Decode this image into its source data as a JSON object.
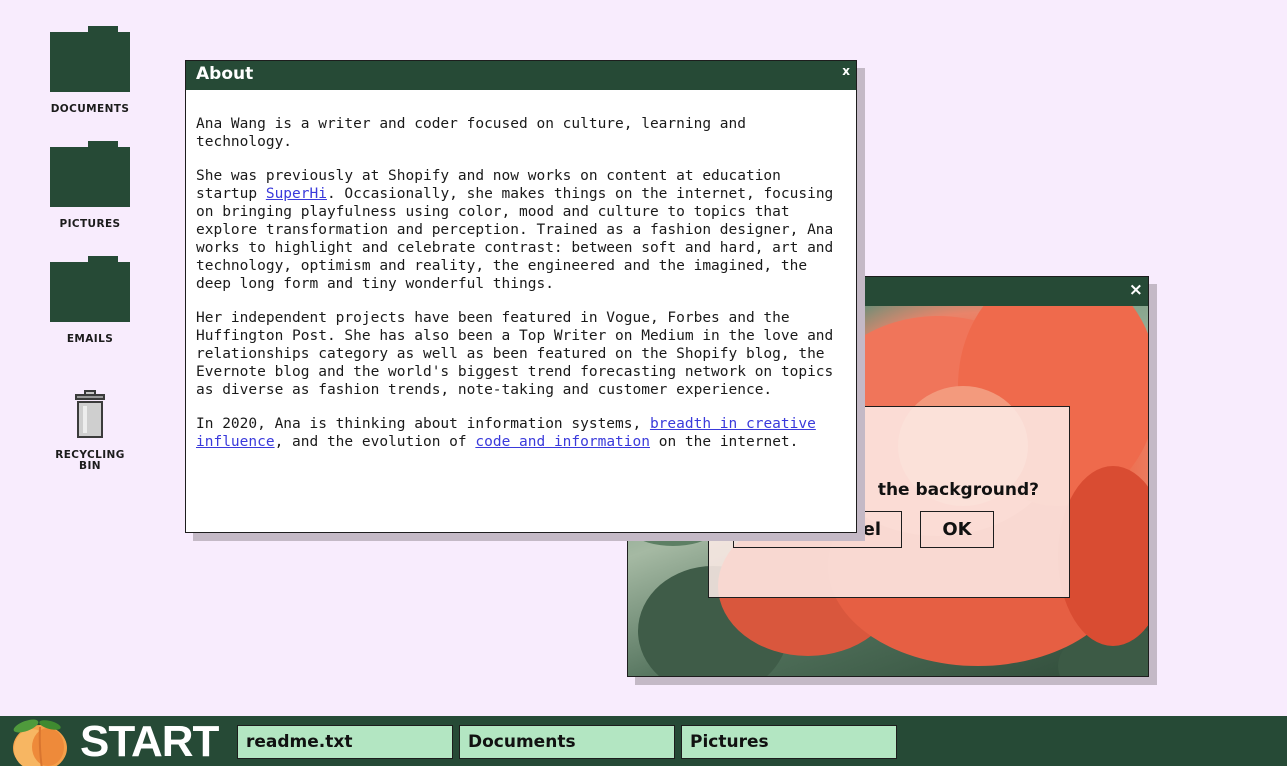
{
  "desktop": {
    "icons": [
      {
        "label": "DOCUMENTS",
        "icon": "folder-icon"
      },
      {
        "label": "PICTURES",
        "icon": "folder-icon"
      },
      {
        "label": "EMAILS",
        "icon": "folder-icon"
      },
      {
        "label": "RECYCLING BIN",
        "icon": "trash-icon"
      }
    ]
  },
  "about_window": {
    "title": "About",
    "close": "x",
    "paragraphs": {
      "p1": "Ana Wang is a writer and coder focused on culture, learning and technology.",
      "p2_before": "She was previously at Shopify and now works on content at education startup ",
      "p2_link": "SuperHi",
      "p2_after": ". Occasionally, she makes things on the internet, focusing on bringing playfulness using color, mood and culture to topics that explore transformation and perception. Trained as a fashion designer, Ana works to highlight and celebrate contrast: between soft and hard, art and technology, optimism and reality, the engineered and the imagined, the deep long form and tiny wonderful things.",
      "p3": "Her independent projects have been featured in Vogue, Forbes and the Huffington Post. She has also been a Top Writer on Medium in the love and relationships category as well as been featured on the Shopify blog, the Evernote blog and the world's biggest trend forecasting network on topics as diverse as fashion trends, note-taking and customer experience.",
      "p4_before": "In 2020, Ana is thinking about information systems, ",
      "p4_link1": "breadth in creative influence",
      "p4_middle": ", and the evolution of ",
      "p4_link2": "code and information",
      "p4_after": " on the internet."
    }
  },
  "photo_window": {
    "close": "×",
    "dialog": {
      "question": "the background?",
      "cancel": "cel",
      "ok": "OK"
    }
  },
  "taskbar": {
    "start": "START",
    "start_icon": "peach-icon",
    "tabs": [
      "readme.txt",
      "Documents",
      "Pictures"
    ]
  },
  "colors": {
    "background": "#f8ecfd",
    "accent": "#264a36",
    "tab": "#b3e6c2",
    "link": "#3a3adb"
  }
}
